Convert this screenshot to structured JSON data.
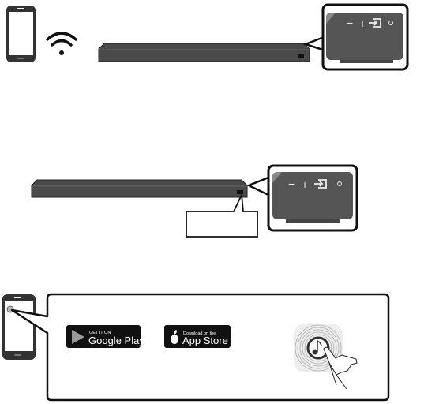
{
  "badges": {
    "google_play": {
      "small": "GET IT ON",
      "large": "Google Play"
    },
    "app_store": {
      "small": "Download on the",
      "large": "App Store"
    }
  },
  "panel_buttons": {
    "minus": "−",
    "plus": "+"
  },
  "icons": [
    "smartphone-icon",
    "wifi-icon",
    "soundbar",
    "button-panel-callout",
    "input-source-icon",
    "power-icon",
    "google-play-logo",
    "apple-logo",
    "music-app-icon",
    "hand-tap-icon"
  ],
  "colors": {
    "device": "#4a4a4a",
    "outline": "#111111",
    "panel": "#555555"
  }
}
